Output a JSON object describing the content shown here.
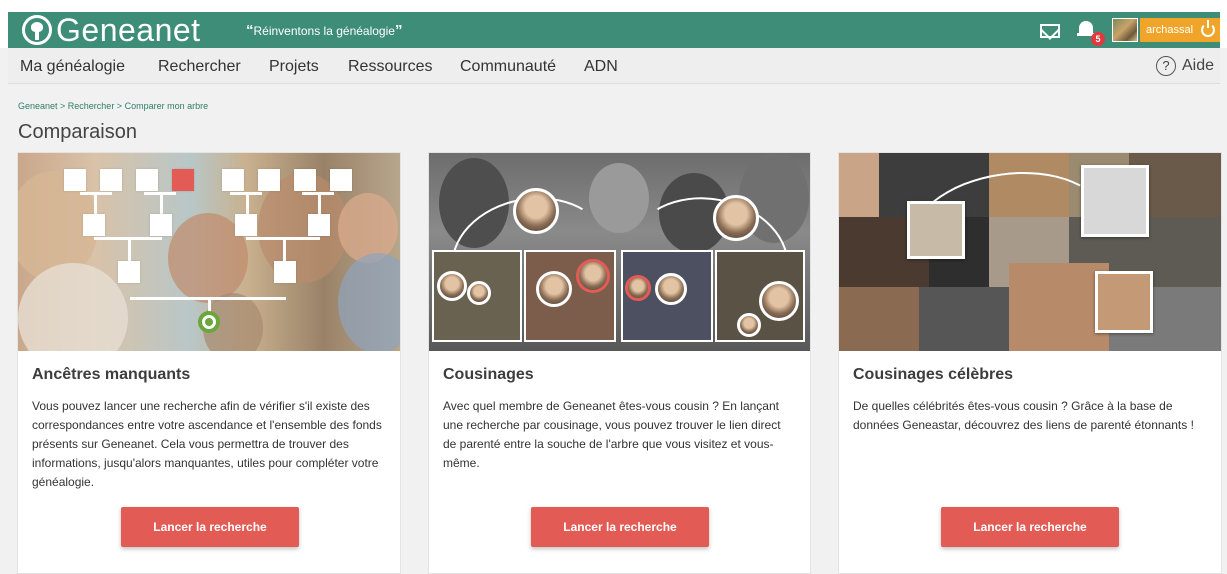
{
  "header": {
    "logo_text": "Geneanet",
    "tagline": "Réinventons la généalogie",
    "notification_count": "5",
    "username": "archassal"
  },
  "nav": {
    "items": [
      "Ma généalogie",
      "Rechercher",
      "Projets",
      "Ressources",
      "Communauté",
      "ADN"
    ],
    "help_label": "Aide"
  },
  "breadcrumb": "Geneanet > Rechercher > Comparer mon arbre",
  "page_title": "Comparaison",
  "cards": [
    {
      "title": "Ancêtres manquants",
      "text": "Vous pouvez lancer une recherche afin de vérifier s'il existe des correspondances entre votre ascendance et l'ensemble des fonds présents sur Geneanet. Cela vous permettra de trouver des informations, jusqu'alors manquantes, utiles pour compléter votre généalogie.",
      "button": "Lancer la recherche"
    },
    {
      "title": "Cousinages",
      "text": "Avec quel membre de Geneanet êtes-vous cousin ? En lançant une recherche par cousinage, vous pouvez trouver le lien direct de parenté entre la souche de l'arbre que vous visitez et vous-même.",
      "button": "Lancer la recherche"
    },
    {
      "title": "Cousinages célèbres",
      "text": "De quelles célébrités êtes-vous cousin ? Grâce à la base de données Geneastar, découvrez des liens de parenté étonnants !",
      "button": "Lancer la recherche"
    }
  ],
  "colors": {
    "brand_green": "#3d8d79",
    "button_red": "#e25c55",
    "user_orange": "#f0a52a"
  }
}
